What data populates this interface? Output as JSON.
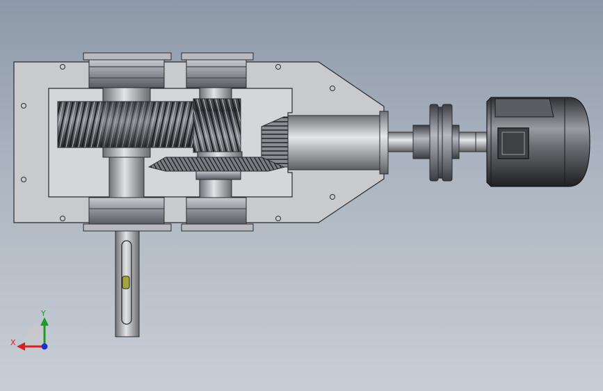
{
  "viewport": {
    "background_top": "#8d99a8",
    "background_bottom": "#c9ced6"
  },
  "model": {
    "housing_color": "#c9cacd",
    "cavity_color": "#d4d5d8",
    "gear_color": "#5f6066",
    "shaft_color": "#9a9ca0",
    "motor_color": "#4a4b4f",
    "key_color": "#a4a53a"
  },
  "triad": {
    "x_label": "X",
    "y_label": "Y",
    "x_color": "#d81e1e",
    "y_color": "#1e9a2a",
    "z_color": "#1e2fd0"
  }
}
